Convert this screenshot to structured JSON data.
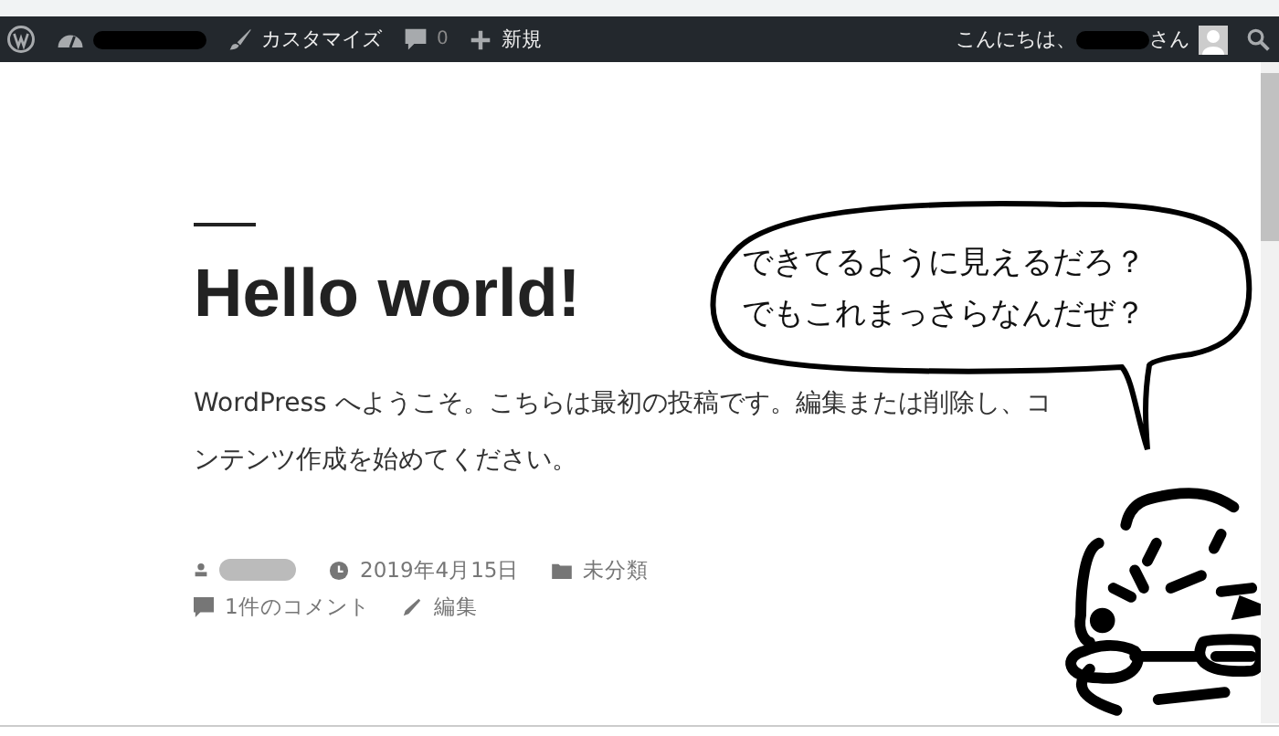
{
  "admin_bar": {
    "items": [
      {
        "kind": "logo"
      },
      {
        "kind": "site",
        "redacted": true
      },
      {
        "kind": "customize",
        "label": "カスタマイズ"
      },
      {
        "kind": "comments",
        "label": "0"
      },
      {
        "kind": "new",
        "label": "新規"
      }
    ],
    "greeting": {
      "before": "こんにちは、",
      "redacted": true,
      "after": "さん"
    }
  },
  "post": {
    "title": "Hello world!",
    "body": "WordPress へようこそ。こちらは最初の投稿です。編集または削除し、コンテンツ作成を始めてください。",
    "meta": [
      {
        "kind": "author",
        "redacted": true
      },
      {
        "kind": "date",
        "label": "2019年4月15日"
      },
      {
        "kind": "category",
        "label": "未分類"
      },
      {
        "kind": "comments",
        "label": "1件のコメント"
      },
      {
        "kind": "edit",
        "label": "編集"
      }
    ]
  },
  "speech_bubble": {
    "lines": [
      "できてるように見えるだろ？",
      "でもこれまっさらなんだぜ？"
    ]
  }
}
